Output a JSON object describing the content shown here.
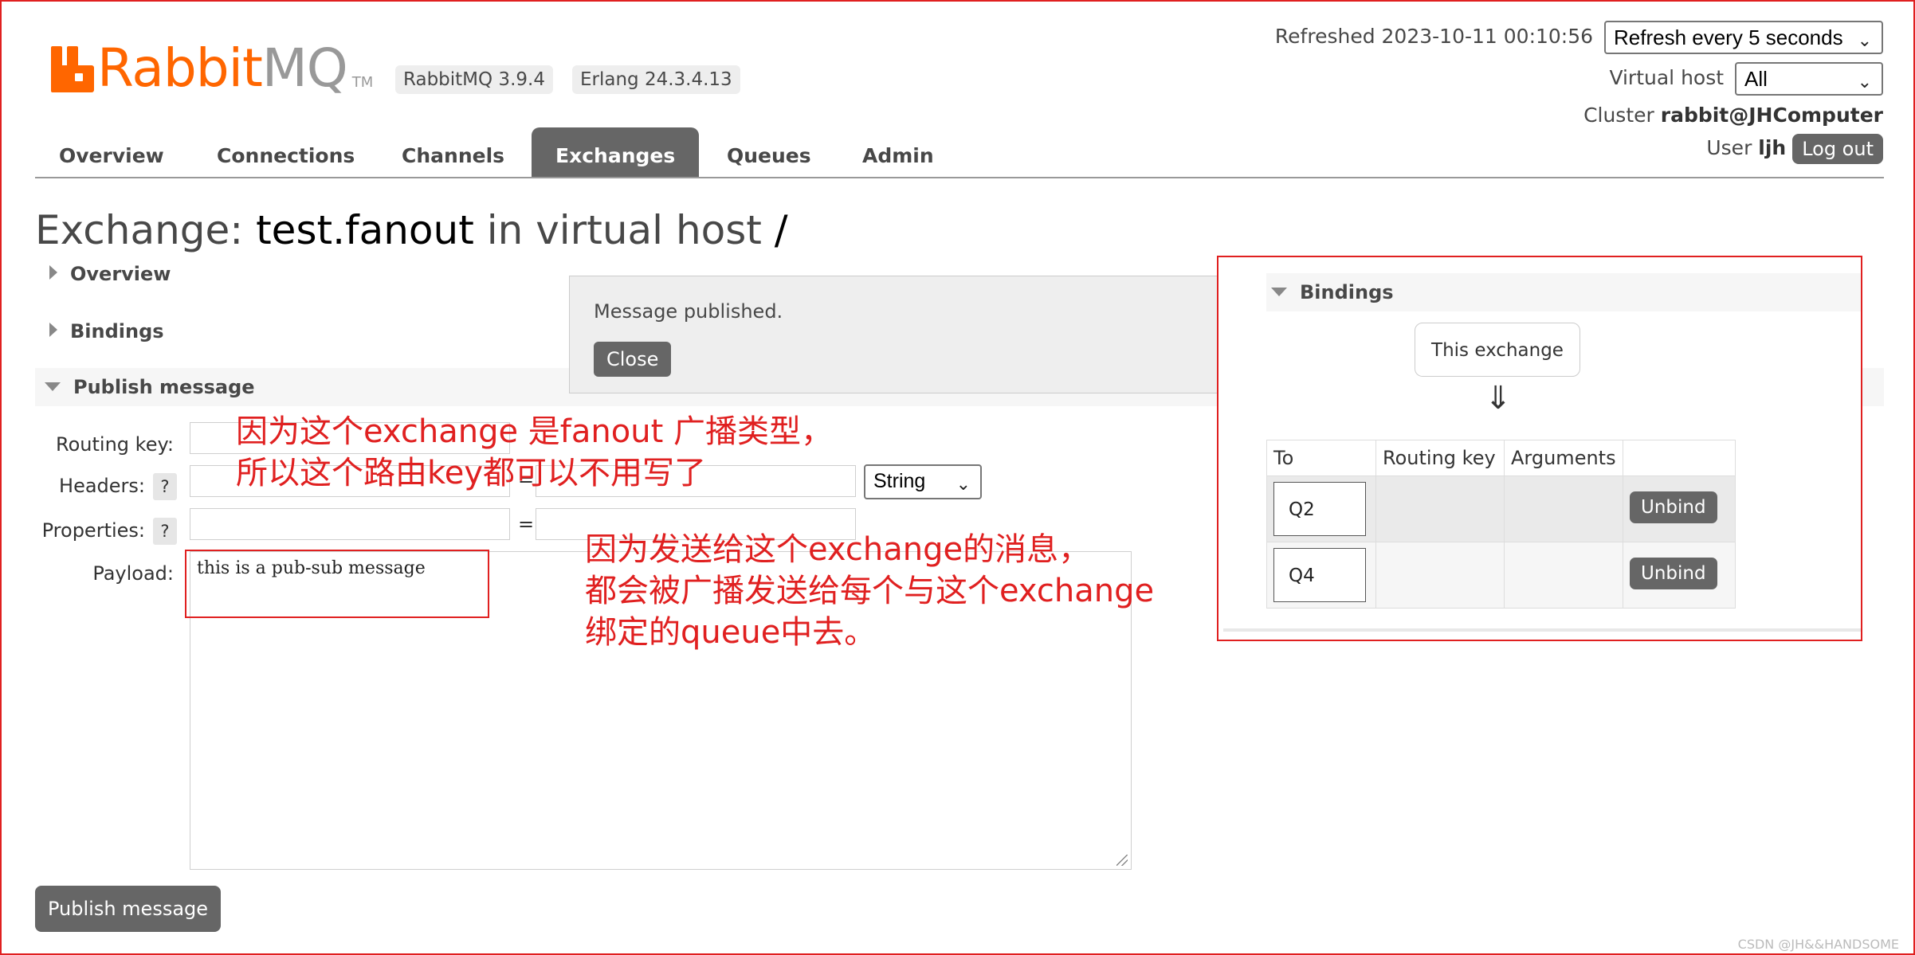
{
  "header": {
    "logo_rabbit": "Rabbit",
    "logo_mq": "MQ",
    "logo_tm": "TM",
    "rabbitmq_version": "RabbitMQ 3.9.4",
    "erlang_version": "Erlang 24.3.4.13",
    "refreshed_label": "Refreshed 2023-10-11 00:10:56",
    "refresh_select": "Refresh every 5 seconds",
    "vhost_label": "Virtual host",
    "vhost_select": "All",
    "cluster_label": "Cluster",
    "cluster_name": "rabbit@JHComputer",
    "user_label": "User",
    "user_name": "ljh",
    "logout_label": "Log out"
  },
  "nav": {
    "tabs": [
      {
        "label": "Overview",
        "active": false
      },
      {
        "label": "Connections",
        "active": false
      },
      {
        "label": "Channels",
        "active": false
      },
      {
        "label": "Exchanges",
        "active": true
      },
      {
        "label": "Queues",
        "active": false
      },
      {
        "label": "Admin",
        "active": false
      }
    ]
  },
  "page": {
    "title_prefix": "Exchange:",
    "exchange_name": "test.fanout",
    "title_mid": "in virtual host",
    "vhost": "/"
  },
  "sections": {
    "overview": "Overview",
    "bindings": "Bindings",
    "publish": "Publish message"
  },
  "form": {
    "routing_key_label": "Routing key:",
    "headers_label": "Headers:",
    "properties_label": "Properties:",
    "payload_label": "Payload:",
    "help": "?",
    "equals": "=",
    "header_type": "String",
    "payload_value": "this is a pub-sub message",
    "publish_button": "Publish message"
  },
  "popup": {
    "message": "Message published.",
    "close_label": "Close"
  },
  "bindings_panel": {
    "title": "Bindings",
    "this_exchange": "This exchange",
    "arrow": "⇓",
    "columns": [
      "To",
      "Routing key",
      "Arguments"
    ],
    "rows": [
      {
        "to": "Q2",
        "routing_key": "",
        "arguments": "",
        "action": "Unbind"
      },
      {
        "to": "Q4",
        "routing_key": "",
        "arguments": "",
        "action": "Unbind"
      }
    ]
  },
  "annotations": {
    "note1_line1": "因为这个exchange 是fanout 广播类型，",
    "note1_line2": "所以这个路由key都可以不用写了",
    "note2_line1": "因为发送给这个exchange的消息，",
    "note2_line2": "都会被广播发送给每个与这个exchange",
    "note2_line3": "绑定的queue中去。",
    "color": "#e02020"
  },
  "watermark": "CSDN @JH&&HANDSOME",
  "colors": {
    "brand_orange": "#ff6600",
    "tab_active": "#666666",
    "annotation_red": "#e02020"
  }
}
